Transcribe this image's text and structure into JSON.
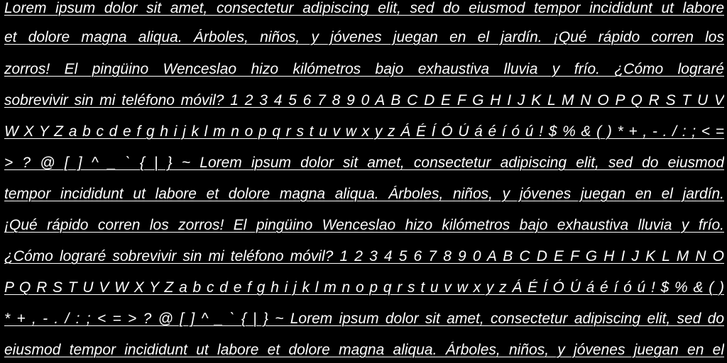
{
  "document": {
    "lines": [
      "Lorem ipsum dolor sit amet, consectetur adipiscing elit, sed do eiusmod tempor incididunt ut labore",
      "et dolore magna aliqua. Árboles, niños, y jóvenes juegan en el jardín. ¡Qué rápido corren los",
      "zorros! El pingüino Wenceslao hizo kilómetros bajo exhaustiva lluvia y frío. ¿Cómo lograré",
      "sobrevivir sin mi teléfono móvil? 1 2 3 4 5 6 7 8 9 0 A B C D E F G H I J K L M N O P Q R S T U V",
      "W X Y Z a b c d e f g h i j k l m n o p q r s t u v w x y z Á É Í Ó Ú á é í ó ú ! $ % & ( ) * + , - . / : ; < =",
      "> ? @ [ ] ^ _ ` { | } ~ Lorem ipsum dolor sit amet, consectetur adipiscing elit, sed do eiusmod",
      "tempor incididunt ut labore et dolore magna aliqua. Árboles, niños, y jóvenes juegan en el jardín.",
      "¡Qué rápido corren los zorros! El pingüino Wenceslao hizo kilómetros bajo exhaustiva lluvia y frío.",
      "¿Cómo lograré sobrevivir sin mi teléfono móvil? 1 2 3 4 5 6 7 8 9 0 A B C D E F G H I J K L M N O",
      "P Q R S T U V W X Y Z a b c d e f g h i j k l m n o p q r s t u v w x y z Á É Í Ó Ú á é í ó ú ! $ % & ( )",
      "* + , - . / : ; < = > ? @ [ ] ^ _ ` { | } ~ Lorem ipsum dolor sit amet, consectetur adipiscing elit, sed do",
      "eiusmod tempor incididunt ut labore et dolore magna aliqua. Árboles, niños, y jóvenes juegan en el"
    ]
  },
  "colors": {
    "background": "#000000",
    "text": "#ffffff"
  }
}
